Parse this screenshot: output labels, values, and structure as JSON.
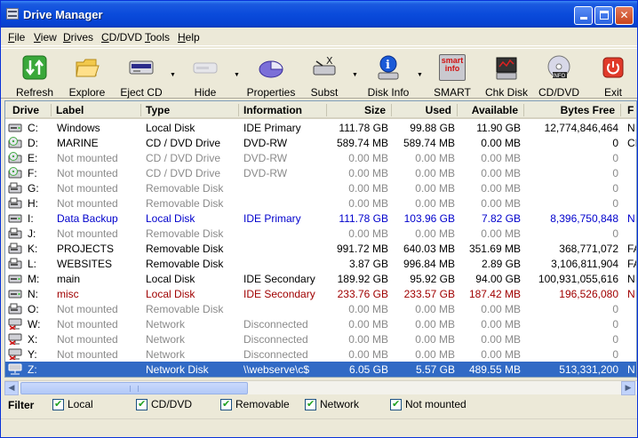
{
  "window": {
    "title": "Drive Manager"
  },
  "menu": [
    {
      "label": "File",
      "hot": "F",
      "rest": "ile"
    },
    {
      "label": "View",
      "hot": "V",
      "rest": "iew"
    },
    {
      "label": "Drives",
      "hot": "D",
      "rest": "rives"
    },
    {
      "label": "CD/DVD",
      "hot": "C",
      "rest": "D/DVD"
    },
    {
      "label": "Tools",
      "hot": "T",
      "rest": "ools"
    },
    {
      "label": "Help",
      "hot": "H",
      "rest": "elp"
    }
  ],
  "toolbar": {
    "refresh": "Refresh",
    "explore": "Explore",
    "eject_cd": "Eject CD",
    "hide": "Hide",
    "properties": "Properties",
    "subst": "Subst",
    "disk_info": "Disk Info",
    "smart": "SMART",
    "smart_icon_text": "smart info",
    "chk_disk": "Chk Disk",
    "cd_dvd": "CD/DVD",
    "cd_dvd_icon_text": "INFO",
    "exit": "Exit"
  },
  "columns": {
    "drive": "Drive",
    "label": "Label",
    "type": "Type",
    "information": "Information",
    "size": "Size",
    "used": "Used",
    "available": "Available",
    "bytes_free": "Bytes Free",
    "extra": "F"
  },
  "rows": [
    {
      "drive": "C:",
      "label": "Windows",
      "type": "Local Disk",
      "info": "IDE Primary",
      "size": "111.78 GB",
      "used": "99.88 GB",
      "avail": "11.90 GB",
      "bytes": "12,774,846,464",
      "extra": "N",
      "style": "normal",
      "icon": "hdd"
    },
    {
      "drive": "D:",
      "label": "MARINE",
      "type": "CD / DVD Drive",
      "info": "DVD-RW",
      "size": "589.74 MB",
      "used": "589.74 MB",
      "avail": "0.00 MB",
      "bytes": "0",
      "extra": "CI",
      "style": "normal",
      "icon": "cd"
    },
    {
      "drive": "E:",
      "label": "Not mounted",
      "type": "CD / DVD Drive",
      "info": "DVD-RW",
      "size": "0.00 MB",
      "used": "0.00 MB",
      "avail": "0.00 MB",
      "bytes": "0",
      "extra": "",
      "style": "dim",
      "icon": "cd"
    },
    {
      "drive": "F:",
      "label": "Not mounted",
      "type": "CD / DVD Drive",
      "info": "DVD-RW",
      "size": "0.00 MB",
      "used": "0.00 MB",
      "avail": "0.00 MB",
      "bytes": "0",
      "extra": "",
      "style": "dim",
      "icon": "cd"
    },
    {
      "drive": "G:",
      "label": "Not mounted",
      "type": "Removable Disk",
      "info": "",
      "size": "0.00 MB",
      "used": "0.00 MB",
      "avail": "0.00 MB",
      "bytes": "0",
      "extra": "",
      "style": "dim",
      "icon": "rem"
    },
    {
      "drive": "H:",
      "label": "Not mounted",
      "type": "Removable Disk",
      "info": "",
      "size": "0.00 MB",
      "used": "0.00 MB",
      "avail": "0.00 MB",
      "bytes": "0",
      "extra": "",
      "style": "dim",
      "icon": "rem"
    },
    {
      "drive": "I:",
      "label": "Data Backup",
      "type": "Local Disk",
      "info": "IDE Primary",
      "size": "111.78 GB",
      "used": "103.96 GB",
      "avail": "7.82 GB",
      "bytes": "8,396,750,848",
      "extra": "N",
      "style": "blue",
      "icon": "hdd"
    },
    {
      "drive": "J:",
      "label": "Not mounted",
      "type": "Removable Disk",
      "info": "",
      "size": "0.00 MB",
      "used": "0.00 MB",
      "avail": "0.00 MB",
      "bytes": "0",
      "extra": "",
      "style": "dim",
      "icon": "rem"
    },
    {
      "drive": "K:",
      "label": "PROJECTS",
      "type": "Removable Disk",
      "info": "",
      "size": "991.72 MB",
      "used": "640.03 MB",
      "avail": "351.69 MB",
      "bytes": "368,771,072",
      "extra": "FA",
      "style": "normal",
      "icon": "rem"
    },
    {
      "drive": "L:",
      "label": "WEBSITES",
      "type": "Removable Disk",
      "info": "",
      "size": "3.87 GB",
      "used": "996.84 MB",
      "avail": "2.89 GB",
      "bytes": "3,106,811,904",
      "extra": "FA",
      "style": "normal",
      "icon": "rem"
    },
    {
      "drive": "M:",
      "label": "main",
      "type": "Local Disk",
      "info": "IDE Secondary",
      "size": "189.92 GB",
      "used": "95.92 GB",
      "avail": "94.00 GB",
      "bytes": "100,931,055,616",
      "extra": "N",
      "style": "normal",
      "icon": "hdd"
    },
    {
      "drive": "N:",
      "label": "misc",
      "type": "Local Disk",
      "info": "IDE Secondary",
      "size": "233.76 GB",
      "used": "233.57 GB",
      "avail": "187.42 MB",
      "bytes": "196,526,080",
      "extra": "N",
      "style": "red",
      "icon": "hdd"
    },
    {
      "drive": "O:",
      "label": "Not mounted",
      "type": "Removable Disk",
      "info": "",
      "size": "0.00 MB",
      "used": "0.00 MB",
      "avail": "0.00 MB",
      "bytes": "0",
      "extra": "",
      "style": "dim",
      "icon": "rem"
    },
    {
      "drive": "W:",
      "label": "Not mounted",
      "type": "Network",
      "info": "Disconnected",
      "size": "0.00 MB",
      "used": "0.00 MB",
      "avail": "0.00 MB",
      "bytes": "0",
      "extra": "",
      "style": "dim",
      "icon": "net"
    },
    {
      "drive": "X:",
      "label": "Not mounted",
      "type": "Network",
      "info": "Disconnected",
      "size": "0.00 MB",
      "used": "0.00 MB",
      "avail": "0.00 MB",
      "bytes": "0",
      "extra": "",
      "style": "dim",
      "icon": "net"
    },
    {
      "drive": "Y:",
      "label": "Not mounted",
      "type": "Network",
      "info": "Disconnected",
      "size": "0.00 MB",
      "used": "0.00 MB",
      "avail": "0.00 MB",
      "bytes": "0",
      "extra": "",
      "style": "dim",
      "icon": "net"
    },
    {
      "drive": "Z:",
      "label": "",
      "type": "Network Disk",
      "info": "\\\\webserve\\c$",
      "size": "6.05 GB",
      "used": "5.57 GB",
      "avail": "489.55 MB",
      "bytes": "513,331,200",
      "extra": "N",
      "style": "selected",
      "icon": "netok"
    }
  ],
  "filter": {
    "label": "Filter",
    "options": [
      {
        "label": "Local",
        "checked": true
      },
      {
        "label": "CD/DVD",
        "checked": true
      },
      {
        "label": "Removable",
        "checked": true
      },
      {
        "label": "Network",
        "checked": true
      },
      {
        "label": "Not mounted",
        "checked": true
      }
    ]
  },
  "colors": {
    "blue_text": "#0000cc",
    "red_text": "#a00000",
    "dim_text": "#8a8a8a",
    "selected_bg": "#316ac5"
  }
}
